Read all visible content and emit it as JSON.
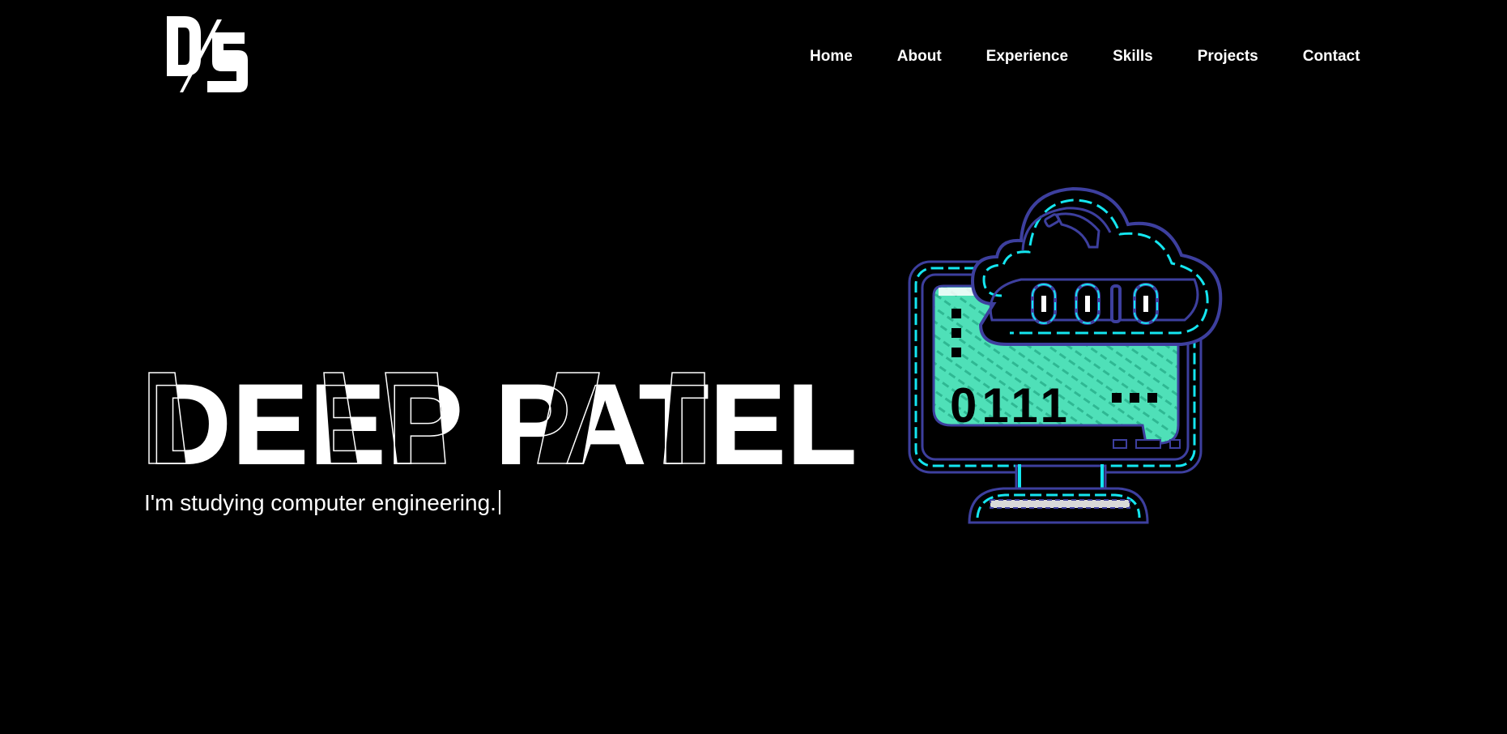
{
  "logo": {
    "text": "DS",
    "icon": "ds-monogram-logo"
  },
  "nav": {
    "items": [
      {
        "label": "Home"
      },
      {
        "label": "About"
      },
      {
        "label": "Experience"
      },
      {
        "label": "Skills"
      },
      {
        "label": "Projects"
      },
      {
        "label": "Contact"
      }
    ]
  },
  "hero": {
    "name": "DEEP PATEL",
    "tagline": "I'm studying computer engineering."
  },
  "illustration": {
    "icon": "cloud-computer-binary-icon",
    "screen_left_binary": "0111",
    "cloud_binary": "0010",
    "colors": {
      "accent": "#4fe0b8",
      "cyan": "#14e6f0",
      "outline": "#3d3f9e"
    }
  },
  "colors": {
    "background": "#000000",
    "text": "#ffffff"
  }
}
